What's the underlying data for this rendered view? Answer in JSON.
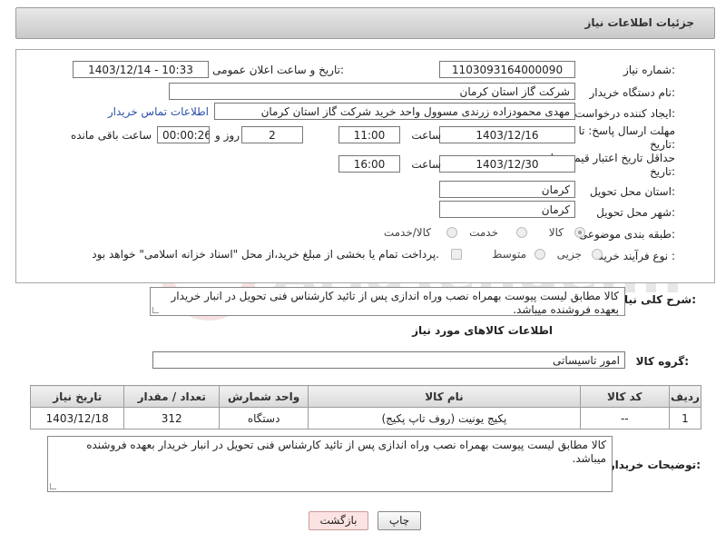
{
  "header": {
    "title": "جزئیات اطلاعات نیاز"
  },
  "fields": {
    "need_number_label": "شماره نیاز:",
    "need_number": "1103093164000090",
    "announce_label": "تاریخ و ساعت اعلان عمومی:",
    "announce_value": "1403/12/14 - 10:33",
    "buyer_org_label": "نام دستگاه خریدار:",
    "buyer_org": "شرکت گاز استان کرمان",
    "creator_label": "ایجاد کننده درخواست:",
    "creator": "مهدی محمودزاده زرندی مسوول واحد خرید شرکت گاز استان کرمان",
    "contact_link": "اطلاعات تماس خریدار",
    "deadline_label_1": "مهلت ارسال پاسخ: تا",
    "deadline_label_2": "تاریخ:",
    "deadline_date": "1403/12/16",
    "time_label": "ساعت",
    "deadline_time": "11:00",
    "days_value": "2",
    "days_label": "روز و",
    "remaining_time": "00:00:26",
    "remaining_label": "ساعت باقی مانده",
    "validity_label_1": "حداقل تاریخ اعتبار قیمت: تا",
    "validity_label_2": "تاریخ:",
    "validity_date": "1403/12/30",
    "validity_time_label": "ساعت",
    "validity_time": "16:00",
    "province_label": "استان محل تحویل:",
    "province": "کرمان",
    "city_label": "شهر محل تحویل:",
    "city": "کرمان",
    "category_label": "طبقه بندی موضوعی:",
    "category_options": [
      "کالا",
      "خدمت",
      "کالا/خدمت"
    ],
    "process_label": "نوع فرآیند خرید :",
    "process_options": [
      "جزیی",
      "متوسط"
    ],
    "payment_note": "پرداخت تمام یا بخشی از مبلغ خرید،از محل \"اسناد خزانه اسلامی\" خواهد بود."
  },
  "summary": {
    "label": "شرح کلی نیاز:",
    "text": "کالا مطابق لیست پیوست بهمراه نصب وراه اندازی پس از تائید کارشناس فنی تحویل در انبار خریدار بعهده فروشنده میباشد."
  },
  "goods_section": {
    "title": "اطلاعات کالاهای مورد نیاز",
    "group_label": "گروه کالا:",
    "group_value": "امور تاسیساتی"
  },
  "table": {
    "headers": [
      "ردیف",
      "کد کالا",
      "نام کالا",
      "واحد شمارش",
      "تعداد / مقدار",
      "تاریخ نیاز"
    ],
    "rows": [
      [
        "1",
        "--",
        "پکیج یونیت (روف تاپ پکیج)",
        "دستگاه",
        "312",
        "1403/12/18"
      ]
    ]
  },
  "buyer_notes": {
    "label": "توضیحات خریدار:",
    "text": "کالا مطابق لیست پیوست بهمراه نصب وراه اندازی پس از تائید کارشناس فنی تحویل در انبار خریدار بعهده فروشنده میباشد."
  },
  "buttons": {
    "print": "چاپ",
    "back": "بازگشت"
  },
  "watermark": {
    "text": "AriaTender.net"
  },
  "colors": {
    "link": "#2a4fa8",
    "back_button": "#fbe3e3",
    "watermark": "#c0392b"
  }
}
